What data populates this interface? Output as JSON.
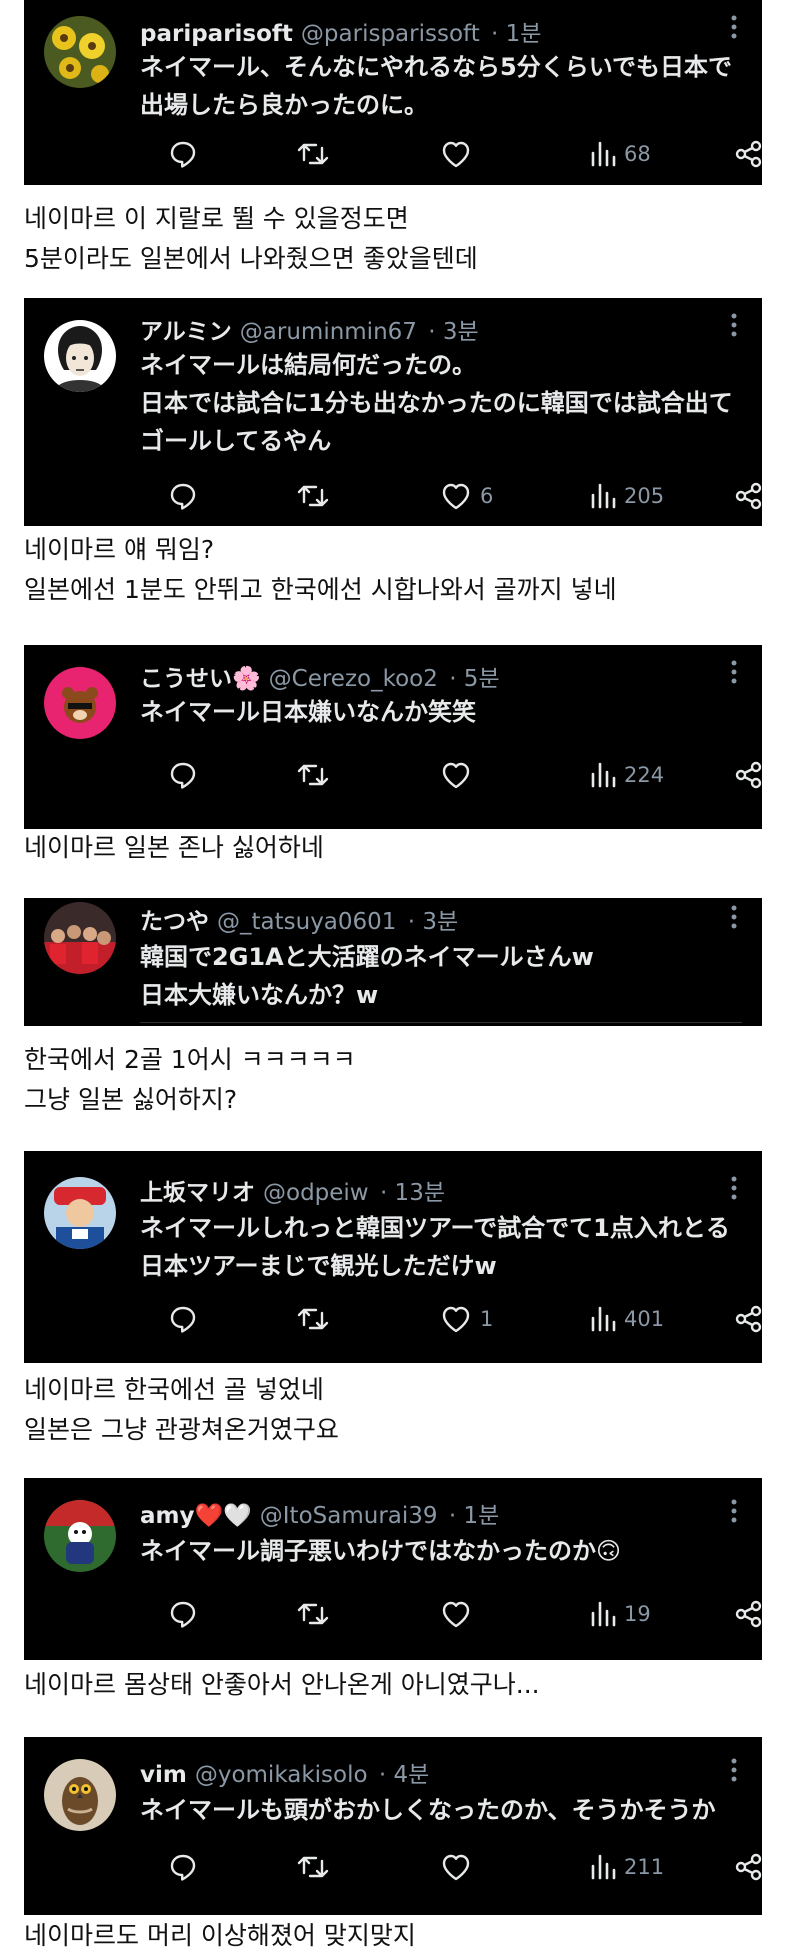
{
  "tweets": [
    {
      "name": "pariparisoft",
      "handle": "@parisparissoft",
      "time": "· 1분",
      "text": "ネイマール、そんなにやれるなら5分くらいでも日本で\n出場したら良かったのに。",
      "likes": "",
      "views": "68",
      "caption": "네이마르 이 지랄로 뛸 수 있을정도면\n5분이라도 일본에서 나와줬으면 좋았을텐데"
    },
    {
      "name": "アルミン",
      "handle": "@aruminmin67",
      "time": "· 3분",
      "text": "ネイマールは結局何だったの。\n日本では試合に1分も出なかったのに韓国では試合出て\nゴールしてるやん",
      "likes": "6",
      "views": "205",
      "caption": "네이마르 얘 뭐임?\n일본에선 1분도 안뛰고 한국에선 시합나와서 골까지 넣네"
    },
    {
      "name": "こうせい🌸",
      "handle": "@Cerezo_koo2",
      "time": "· 5분",
      "text": "ネイマール日本嫌いなんか笑笑",
      "likes": "",
      "views": "224",
      "caption": "네이마르 일본 존나 싫어하네"
    },
    {
      "name": "たつや",
      "handle": "@_tatsuya0601",
      "time": "· 3분",
      "text": "韓国で2G1Aと大活躍のネイマールさんw\n日本大嫌いなんか？w",
      "likes": "",
      "views": "",
      "caption": "한국에서 2골 1어시 ㅋㅋㅋㅋㅋ\n그냥 일본 싫어하지?"
    },
    {
      "name": "上坂マリオ",
      "handle": "@odpeiw",
      "time": "· 13분",
      "text": "ネイマールしれっと韓国ツアーで試合でて1点入れとる\n日本ツアーまじで観光しただけw",
      "likes": "1",
      "views": "401",
      "caption": "네이마르 한국에선 골 넣었네\n일본은 그냥 관광쳐온거였구요"
    },
    {
      "name": "amy❤️🤍",
      "handle": "@ItoSamurai39",
      "time": "· 1분",
      "text": "ネイマール調子悪いわけではなかったのか🙃",
      "likes": "",
      "views": "19",
      "caption": "네이마르  몸상태 안좋아서 안나온게 아니였구나..."
    },
    {
      "name": "vim",
      "handle": "@yomikakisolo",
      "time": "· 4분",
      "text": "ネイマールも頭がおかしくなったのか、そうかそうか",
      "likes": "",
      "views": "211",
      "caption": "네이마르도 머리 이상해졌어 맞지맞지"
    }
  ],
  "icons": {
    "reply": "reply-icon",
    "retweet": "retweet-icon",
    "like": "heart-icon",
    "views": "views-icon",
    "share": "share-icon",
    "more": "more-icon"
  },
  "colors": {
    "card_bg": "#000000",
    "text": "#e7e9ea",
    "muted": "#8b98a5"
  }
}
